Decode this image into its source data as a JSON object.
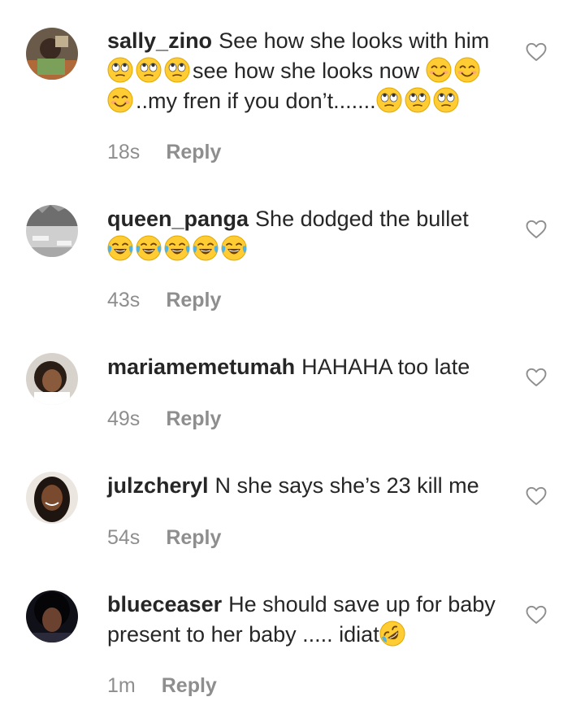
{
  "reply_label": "Reply",
  "comments": [
    {
      "username": "sally_zino",
      "parts": [
        "See how she looks with him",
        "see how she looks now",
        "..my fren if you don’t......."
      ],
      "time": "18s"
    },
    {
      "username": "queen_panga",
      "parts": [
        "She dodged the bullet"
      ],
      "time": "43s"
    },
    {
      "username": "mariamemetumah",
      "parts": [
        "HAHAHA too late"
      ],
      "time": "49s"
    },
    {
      "username": "julzcheryl",
      "parts": [
        "N she says she’s 23 kill me"
      ],
      "time": "54s"
    },
    {
      "username": "blueceaser",
      "parts": [
        "He should save up for baby present to her baby ..... idiat"
      ],
      "time": "1m"
    }
  ],
  "icons": {
    "heart": "heart-outline-icon",
    "emoji_eyeroll": "face-with-rolling-eyes-emoji",
    "emoji_smile": "smiling-face-with-smiling-eyes-emoji",
    "emoji_laugh": "face-with-tears-of-joy-emoji",
    "emoji_rofl": "rolling-on-floor-laughing-emoji"
  },
  "colors": {
    "text": "#262626",
    "meta": "#8e8e8e",
    "heart": "#8e8e8e",
    "emoji_yellow": "#FFCC33"
  }
}
